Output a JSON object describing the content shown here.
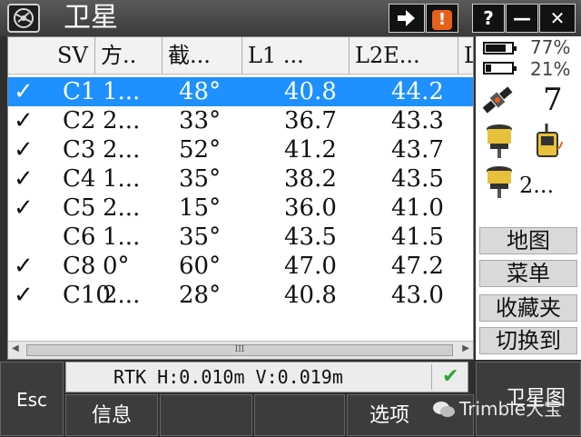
{
  "window": {
    "title": "卫星",
    "buttons": {
      "help": "?",
      "minimize": "—",
      "close": "✕"
    },
    "indicators": {
      "arrow_icon": "arrow-right-icon",
      "warning": "!"
    }
  },
  "table": {
    "columns": [
      "SV",
      "方..",
      "截...",
      "L1 ...",
      "L2E...",
      "L"
    ],
    "rows": [
      {
        "checked": "✓",
        "sv": "C1",
        "dir": "1...",
        "elev": "48°",
        "l1": "40.8",
        "l2e": "44.2",
        "selected": true
      },
      {
        "checked": "✓",
        "sv": "C2",
        "dir": "2...",
        "elev": "33°",
        "l1": "36.7",
        "l2e": "43.3"
      },
      {
        "checked": "✓",
        "sv": "C3",
        "dir": "2...",
        "elev": "52°",
        "l1": "41.2",
        "l2e": "43.7"
      },
      {
        "checked": "✓",
        "sv": "C4",
        "dir": "1...",
        "elev": "35°",
        "l1": "38.2",
        "l2e": "43.5"
      },
      {
        "checked": "✓",
        "sv": "C5",
        "dir": "2...",
        "elev": "15°",
        "l1": "36.0",
        "l2e": "41.0"
      },
      {
        "checked": "",
        "sv": "C6",
        "dir": "1...",
        "elev": "35°",
        "l1": "43.5",
        "l2e": "41.5"
      },
      {
        "checked": "✓",
        "sv": "C8",
        "dir": "0°",
        "elev": "60°",
        "l1": "47.0",
        "l2e": "47.2"
      },
      {
        "checked": "✓",
        "sv": "C10",
        "dir": "2...",
        "elev": "28°",
        "l1": "40.8",
        "l2e": "43.0"
      }
    ],
    "scroll_grip": "III"
  },
  "side_panel": {
    "battery1": "77%",
    "battery1_level": 0.77,
    "battery2": "21%",
    "battery2_level": 0.21,
    "satellite_count": "7",
    "receiver2_label": "2...",
    "buttons": [
      "地图",
      "菜单",
      "收藏夹",
      "切换到"
    ]
  },
  "status": {
    "text": "RTK H:0.010m V:0.019m",
    "ok_icon": "check-icon"
  },
  "footer": {
    "esc": "Esc",
    "info": "信息",
    "options": "选项",
    "skyplot": "卫星图",
    "watermark": "Trimble大宝"
  },
  "colors": {
    "selection": "#1E90FF",
    "warning": "#E8611A",
    "ok": "#2FA52F",
    "titlebar": "#4A4A4A"
  }
}
